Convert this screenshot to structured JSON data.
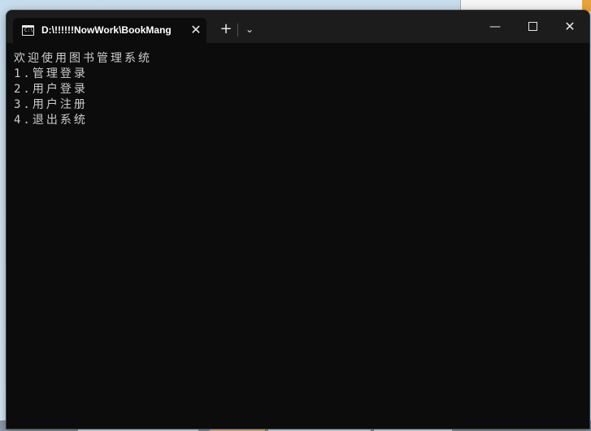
{
  "window": {
    "tab_title": "D:\\!!!!!!NowWork\\BookMang",
    "tab_icon": "terminal-icon",
    "tab_icon_text": "C:\\",
    "close_tab_glyph": "✕",
    "new_tab_glyph": "+",
    "dropdown_glyph": "⌄",
    "minimize_glyph": "—",
    "close_glyph": "✕"
  },
  "console": {
    "lines": [
      "欢迎使用图书管理系统",
      "1.管理登录",
      "2.用户登录",
      "3.用户注册",
      "4.退出系统"
    ]
  },
  "colors": {
    "console_bg": "#0c0c0c",
    "titlebar_bg": "#1c1c1c",
    "text": "#cccccc"
  }
}
